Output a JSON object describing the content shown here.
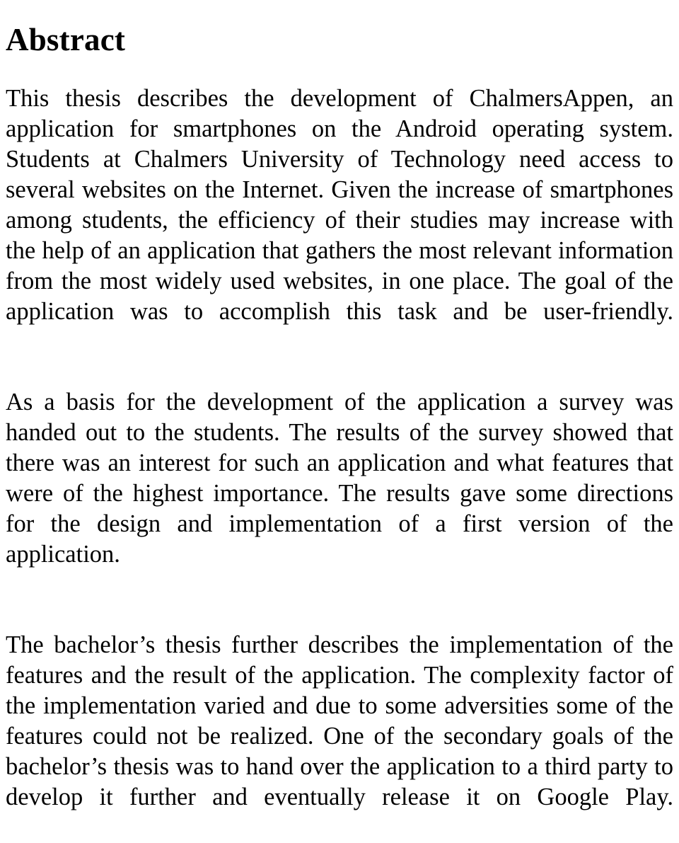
{
  "document": {
    "heading": "Abstract",
    "background_color": "#ffffff",
    "text_color": "#000000",
    "paragraphs": [
      {
        "id": "abstract-paragraph-1",
        "text": "This thesis describes the development of ChalmersAppen, an application for smartphones on the Android operating system. Students at Chalmers University of Technology need access to several websites on the Internet. Given the increase of smartphones among students, the efficiency of their studies may increase with the help of an application that gathers the most relevant information from the most widely used websites, in one place. The goal of the application was to accomplish this task and be user-friendly."
      },
      {
        "id": "abstract-paragraph-2",
        "text": "As a basis for the development of the application a survey was handed out to the students. The results of the survey showed that there was an interest for such an application and what features that were of the highest importance. The results gave some directions for the design and implementation of a first version of the application."
      },
      {
        "id": "abstract-paragraph-3",
        "text": "The bachelor’s thesis further describes the implementation of the features and the result of the application. The complexity factor of the implementation varied and due to some adversities some of the features could not be realized. One of the secondary goals of the bachelor’s thesis was to hand over the application to a third party to develop it further and eventually release it on Google Play."
      }
    ]
  }
}
